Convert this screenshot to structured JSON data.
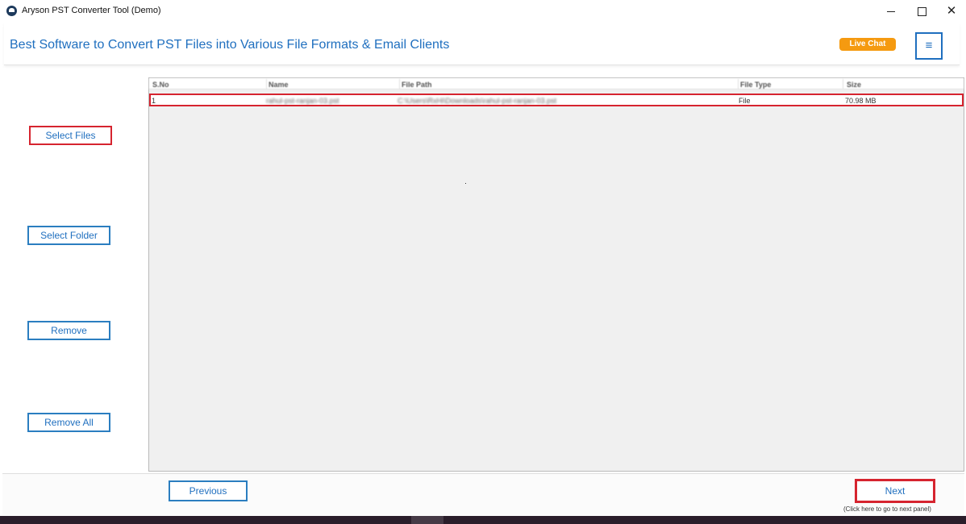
{
  "window": {
    "title": "Aryson PST Converter Tool (Demo)",
    "controls": {
      "minimize": "",
      "maximize": "",
      "close": "✕"
    }
  },
  "header": {
    "title": "Best Software to Convert PST Files into Various File Formats & Email Clients",
    "live_chat": "Live Chat",
    "menu_icon": "≡"
  },
  "sidebar": {
    "select_files": "Select Files",
    "select_folder": "Select Folder",
    "remove": "Remove",
    "remove_all": "Remove All"
  },
  "table": {
    "columns": [
      "S.No",
      "Name",
      "File Path",
      "File Type",
      "Size"
    ],
    "rows": [
      {
        "index": "1",
        "name": "rahul-pst-ranjan-03.pst",
        "path": "C:\\Users\\RxHi\\Downloads\\rahul-pst-ranjan-03.pst",
        "type": "File",
        "size": "70.98 MB"
      }
    ]
  },
  "footer": {
    "previous": "Previous",
    "next": "Next",
    "next_hint": "(Click here to go to next panel)"
  },
  "colors": {
    "accent": "#1f6fbf",
    "highlight": "#d6242f",
    "live_chat": "#f59a10"
  }
}
